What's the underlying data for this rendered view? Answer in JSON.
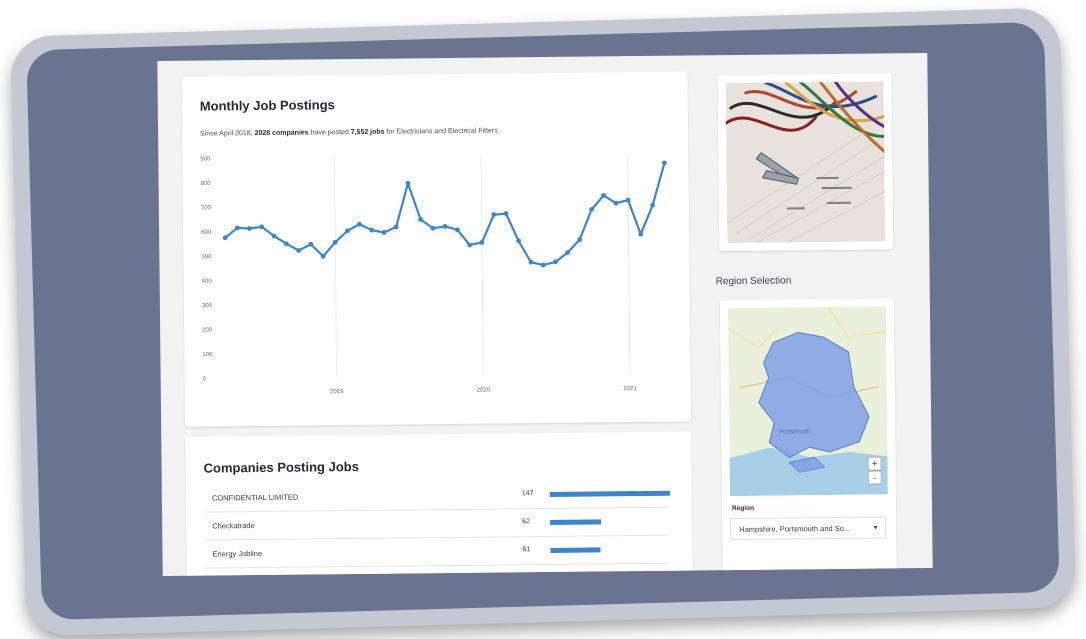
{
  "chart_card": {
    "title": "Monthly Job Postings",
    "subtitle_prefix": "Since April 2018, ",
    "companies_count": "2028 companies",
    "subtitle_middle": " have posted ",
    "jobs_count": "7,552 jobs",
    "subtitle_suffix": " for Electricians and Electrical Fitters."
  },
  "chart_data": {
    "type": "line",
    "title": "Monthly Job Postings",
    "xlabel": "",
    "ylabel": "",
    "ylim": [
      0,
      900
    ],
    "yticks": [
      0,
      100,
      200,
      300,
      400,
      500,
      600,
      700,
      800,
      900
    ],
    "xticks": [
      {
        "label": "2019",
        "index": 9
      },
      {
        "label": "2020",
        "index": 21
      },
      {
        "label": "2021",
        "index": 33
      }
    ],
    "grid": "vertical at year ticks",
    "color": "#3d86cc",
    "x": [
      "2018-04",
      "2018-05",
      "2018-06",
      "2018-07",
      "2018-08",
      "2018-09",
      "2018-10",
      "2018-11",
      "2018-12",
      "2019-01",
      "2019-02",
      "2019-03",
      "2019-04",
      "2019-05",
      "2019-06",
      "2019-07",
      "2019-08",
      "2019-09",
      "2019-10",
      "2019-11",
      "2019-12",
      "2020-01",
      "2020-02",
      "2020-03",
      "2020-04",
      "2020-05",
      "2020-06",
      "2020-07",
      "2020-08",
      "2020-09",
      "2020-10",
      "2020-11",
      "2020-12",
      "2021-01",
      "2021-02",
      "2021-03",
      "2021-04"
    ],
    "series": [
      {
        "values": [
          575,
          615,
          612,
          618,
          580,
          548,
          520,
          545,
          495,
          552,
          598,
          625,
          600,
          590,
          612,
          790,
          642,
          605,
          612,
          598,
          535,
          545,
          658,
          662,
          550,
          462,
          450,
          462,
          500,
          552,
          675,
          732,
          700,
          712,
          572,
          690,
          862
        ]
      }
    ]
  },
  "companies_card": {
    "title": "Companies Posting Jobs",
    "max_count": 147,
    "rows": [
      {
        "name": "CONFIDENTIAL LIMITED",
        "count": "147",
        "value": 147
      },
      {
        "name": "Checkatrade",
        "count": "62",
        "value": 62
      },
      {
        "name": "Energy Jobline",
        "count": "61",
        "value": 61
      }
    ]
  },
  "region": {
    "heading": "Region Selection",
    "label": "Region",
    "selected": "Hampshire, Portsmouth and So...",
    "map_label": "Portsmouth",
    "zoom_in": "+",
    "zoom_out": "-"
  },
  "icons": {
    "select_caret": "▾",
    "photo": "wires-photo"
  }
}
